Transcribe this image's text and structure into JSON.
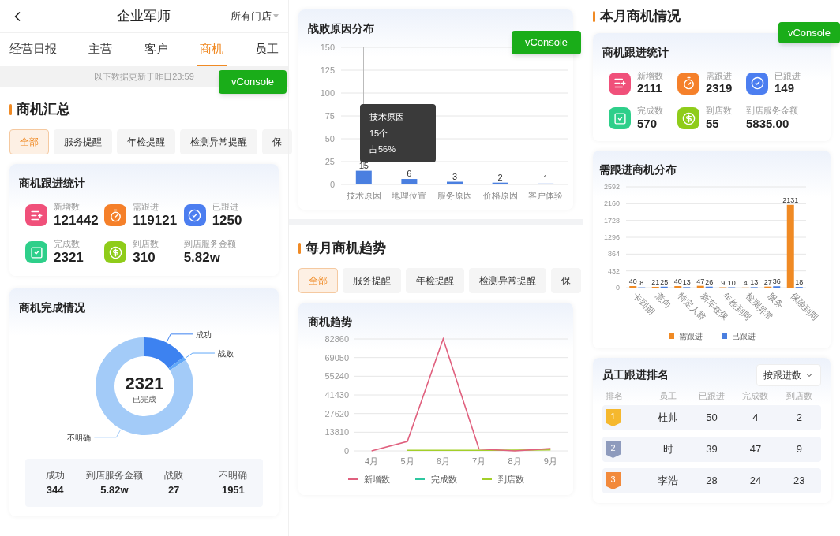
{
  "header": {
    "title": "企业军师",
    "store_selector": "所有门店"
  },
  "tabs": [
    {
      "label": "经营日报",
      "selected": false
    },
    {
      "label": "主营",
      "selected": false
    },
    {
      "label": "客户",
      "selected": false
    },
    {
      "label": "商机",
      "selected": true
    },
    {
      "label": "员工",
      "selected": false
    }
  ],
  "update_notice": "以下数据更新于昨日23:59",
  "vconsole_buttons": [
    "vConsole",
    "vConsole",
    "vConsole"
  ],
  "summary": {
    "title": "商机汇总",
    "filters": [
      {
        "label": "全部",
        "selected": true
      },
      {
        "label": "服务提醒",
        "selected": false
      },
      {
        "label": "年检提醒",
        "selected": false
      },
      {
        "label": "检测异常提醒",
        "selected": false
      },
      {
        "label": "保",
        "selected": false
      }
    ],
    "follow_stats": {
      "title": "商机跟进统计",
      "items": [
        {
          "kind": "new",
          "label": "新增数",
          "value": "121442"
        },
        {
          "kind": "pending",
          "label": "需跟进",
          "value": "119121"
        },
        {
          "kind": "followed",
          "label": "已跟进",
          "value": "1250"
        },
        {
          "kind": "done",
          "label": "完成数",
          "value": "2321"
        },
        {
          "kind": "visit",
          "label": "到店数",
          "value": "310"
        },
        {
          "kind": "amount",
          "label": "到店服务金额",
          "value": "5.82w"
        }
      ]
    },
    "completion": {
      "title": "商机完成情况",
      "center_value": "2321",
      "center_label": "已完成",
      "chart_data": {
        "type": "donut",
        "categories": [
          "成功",
          "战败",
          "不明确"
        ],
        "values": [
          14.8,
          1.2,
          84.0
        ]
      },
      "totals": [
        {
          "label": "成功",
          "value": "344"
        },
        {
          "label": "到店服务金额",
          "value": "5.82w"
        },
        {
          "label": "战败",
          "value": "27"
        },
        {
          "label": "不明确",
          "value": "1951"
        }
      ]
    }
  },
  "defeat_reasons": {
    "title": "战败原因分布",
    "chart_data": {
      "type": "bar",
      "categories": [
        "技术原因",
        "地理位置",
        "服务原因",
        "价格原因",
        "客户体验"
      ],
      "values": [
        15,
        6,
        3,
        2,
        1
      ],
      "ylim": [
        0,
        150
      ],
      "yticks": [
        0,
        25,
        50,
        75,
        100,
        125,
        150
      ],
      "grid": true,
      "data_labels": true
    },
    "tooltip": [
      "技术原因",
      "15个",
      "占56%"
    ]
  },
  "monthly_trend": {
    "title": "每月商机趋势",
    "filters": [
      {
        "label": "全部",
        "selected": true
      },
      {
        "label": "服务提醒",
        "selected": false
      },
      {
        "label": "年检提醒",
        "selected": false
      },
      {
        "label": "检测异常提醒",
        "selected": false
      },
      {
        "label": "保",
        "selected": false
      }
    ],
    "chart_title": "商机趋势",
    "chart_data": {
      "type": "line",
      "x": [
        "4月",
        "5月",
        "6月",
        "7月",
        "8月",
        "9月"
      ],
      "ylim": [
        0,
        82860
      ],
      "yticks": [
        0,
        13810,
        27620,
        41430,
        55240,
        69050,
        82860
      ],
      "grid": true,
      "legend": true,
      "series": [
        {
          "name": "新增数",
          "color": "#e0607e",
          "values": [
            0,
            7000,
            82860,
            1400,
            0,
            1700
          ]
        },
        {
          "name": "完成数",
          "color": "#2ec7a0",
          "values": [
            null,
            null,
            null,
            null,
            null,
            null
          ]
        },
        {
          "name": "到店数",
          "color": "#a3cf2a",
          "values": [
            null,
            400,
            400,
            400,
            500,
            700
          ]
        }
      ]
    }
  },
  "month": {
    "title": "本月商机情况",
    "follow_stats": {
      "title": "商机跟进统计",
      "items": [
        {
          "kind": "new",
          "label": "新增数",
          "value": "2111"
        },
        {
          "kind": "pending",
          "label": "需跟进",
          "value": "2319"
        },
        {
          "kind": "followed",
          "label": "已跟进",
          "value": "149"
        },
        {
          "kind": "done",
          "label": "完成数",
          "value": "570"
        },
        {
          "kind": "visit",
          "label": "到店数",
          "value": "55"
        },
        {
          "kind": "amount",
          "label": "到店服务金额",
          "value": "5835.00"
        }
      ]
    },
    "distribution": {
      "title": "需跟进商机分布",
      "chart_data": {
        "type": "bar",
        "categories": [
          "卡到期",
          "意向",
          "特定人群",
          "新车在保",
          "年检到期",
          "检测异常",
          "服务",
          "保险到期"
        ],
        "ylim": [
          0,
          2592
        ],
        "yticks": [
          0,
          432,
          864,
          1296,
          1728,
          2160,
          2592
        ],
        "grid": true,
        "legend": true,
        "data_labels": true,
        "series": [
          {
            "name": "需跟进",
            "color": "#f08a24",
            "values": [
              40,
              21,
              40,
              47,
              9,
              4,
              27,
              2131
            ]
          },
          {
            "name": "已跟进",
            "color": "#4a7fe0",
            "values": [
              8,
              25,
              13,
              26,
              10,
              13,
              36,
              18
            ]
          }
        ]
      }
    },
    "ranking": {
      "title": "员工跟进排名",
      "sort_selector": "按跟进数",
      "columns": [
        "排名",
        "员工",
        "已跟进",
        "完成数",
        "到店数"
      ],
      "rows": [
        {
          "rank": "1",
          "color": "#f5b82e",
          "name": "杜帅",
          "followed": "50",
          "completed": "4",
          "visited": "2"
        },
        {
          "rank": "2",
          "color": "#8e9bbd",
          "name": "时",
          "followed": "39",
          "completed": "47",
          "visited": "9"
        },
        {
          "rank": "3",
          "color": "#f28a3c",
          "name": "李浩",
          "followed": "28",
          "completed": "24",
          "visited": "23"
        }
      ]
    }
  }
}
